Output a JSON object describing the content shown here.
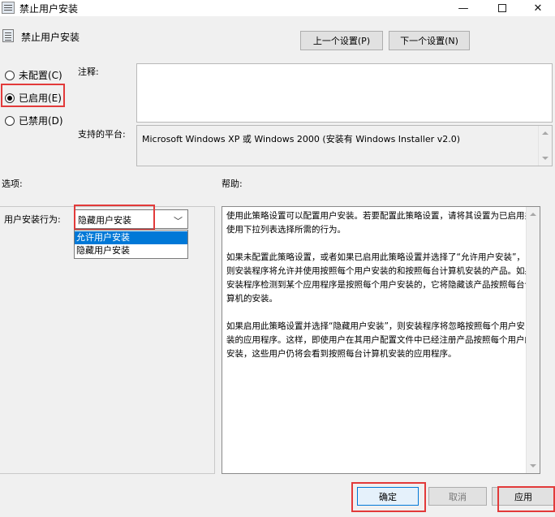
{
  "window": {
    "title": "禁止用户安装",
    "minimize_glyph": "—",
    "close_glyph": "✕"
  },
  "header": {
    "policy_name": "禁止用户安装",
    "prev_button": "上一个设置(P)",
    "next_button": "下一个设置(N)"
  },
  "state": {
    "options": [
      {
        "label": "未配置(C)",
        "checked": false
      },
      {
        "label": "已启用(E)",
        "checked": true
      },
      {
        "label": "已禁用(D)",
        "checked": false
      }
    ]
  },
  "comment": {
    "label": "注释:",
    "value": ""
  },
  "platform": {
    "label": "支持的平台:",
    "value": "Microsoft Windows XP 或 Windows 2000 (安装有 Windows Installer v2.0)"
  },
  "sections": {
    "options_label": "选项:",
    "help_label": "帮助:"
  },
  "options_panel": {
    "install_behavior_label": "用户安装行为:",
    "selected_value": "隐藏用户安装",
    "dropdown_items": [
      "允许用户安装",
      "隐藏用户安装"
    ]
  },
  "help": {
    "paragraphs": [
      "使用此策略设置可以配置用户安装。若要配置此策略设置，请将其设置为已启用并使用下拉列表选择所需的行为。",
      "如果未配置此策略设置，或者如果已启用此策略设置并选择了“允许用户安装”，则安装程序将允许并使用按照每个用户安装的和按照每台计算机安装的产品。如果安装程序检测到某个应用程序是按照每个用户安装的，它将隐藏该产品按照每台计算机的安装。",
      "如果启用此策略设置并选择“隐藏用户安装”，则安装程序将忽略按照每个用户安装的应用程序。这样，即使用户在其用户配置文件中已经注册产品按照每个用户的安装，这些用户仍将会看到按照每台计算机安装的应用程序。"
    ]
  },
  "footer": {
    "ok_button": "确定",
    "cancel_button": "取消",
    "apply_button": "应用"
  },
  "colors": {
    "highlight": "#e23a3a",
    "selection": "#0078d7"
  }
}
